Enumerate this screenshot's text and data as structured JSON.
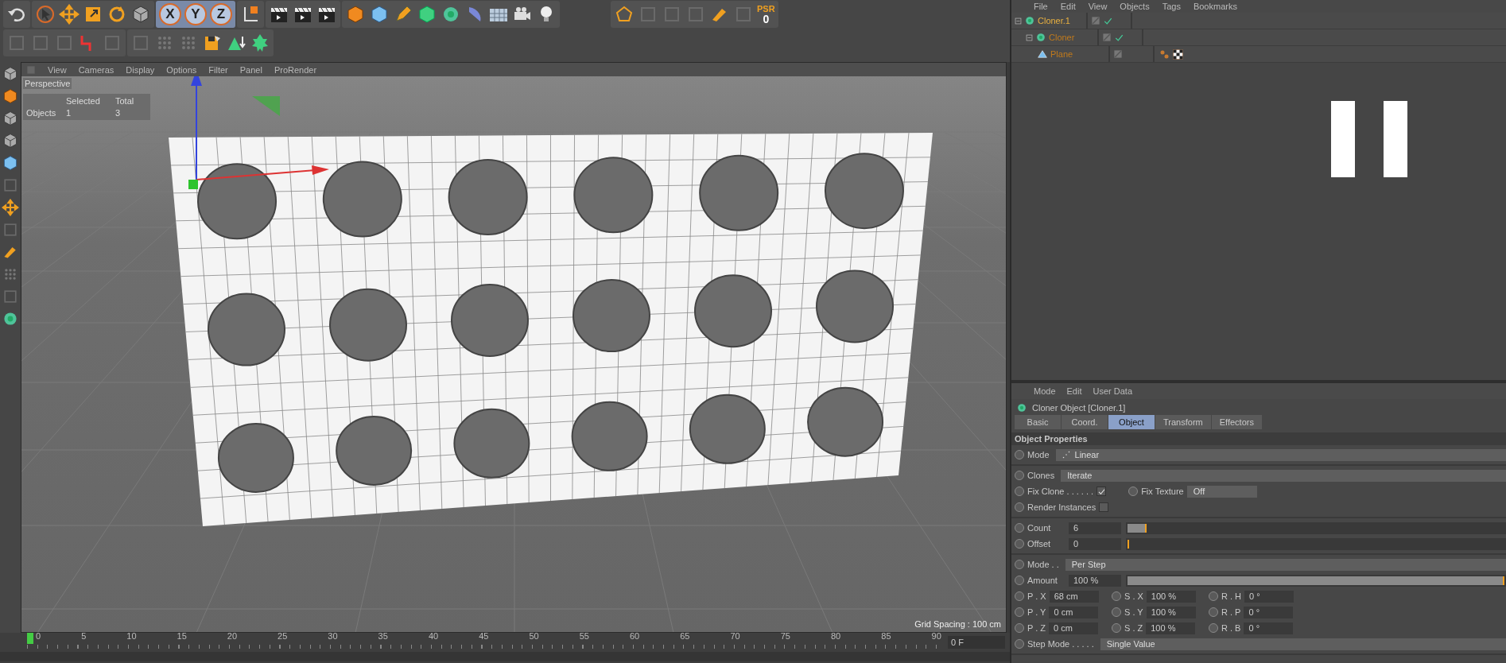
{
  "toolbar": {
    "axis_buttons": [
      {
        "label": "X",
        "selected": true
      },
      {
        "label": "Y",
        "selected": true
      },
      {
        "label": "Z",
        "selected": true
      }
    ],
    "psr": {
      "label": "PSR",
      "value": "0"
    }
  },
  "viewport": {
    "menu": [
      "View",
      "Cameras",
      "Display",
      "Options",
      "Filter",
      "Panel",
      "ProRender"
    ],
    "camera": "Perspective",
    "stats": {
      "columns": [
        "Selected",
        "Total"
      ],
      "rows": [
        {
          "label": "Objects",
          "selected": "1",
          "total": "3"
        }
      ]
    },
    "grid_spacing": "Grid Spacing : 100 cm"
  },
  "timeline": {
    "ticks": [
      "0",
      "5",
      "10",
      "15",
      "20",
      "25",
      "30",
      "35",
      "40",
      "45",
      "50",
      "55",
      "60",
      "65",
      "70",
      "75",
      "80",
      "85",
      "90"
    ],
    "frame": "0 F"
  },
  "object_manager": {
    "menu": [
      "File",
      "Edit",
      "View",
      "Objects",
      "Tags",
      "Bookmarks"
    ],
    "tree": [
      {
        "name": "Cloner.1",
        "kind": "cloner",
        "active": true,
        "enabled": true,
        "expanded": true,
        "children": [
          {
            "name": "Cloner",
            "kind": "cloner",
            "active": false,
            "enabled": true,
            "expanded": true,
            "children": [
              {
                "name": "Plane",
                "kind": "plane",
                "active": false,
                "enabled": false,
                "tags": true
              }
            ]
          }
        ]
      }
    ]
  },
  "attributes": {
    "menu": [
      "Mode",
      "Edit",
      "User Data"
    ],
    "title": "Cloner Object [Cloner.1]",
    "tabs": [
      {
        "label": "Basic",
        "selected": false
      },
      {
        "label": "Coord.",
        "selected": false
      },
      {
        "label": "Object",
        "selected": true
      },
      {
        "label": "Transform",
        "selected": false
      },
      {
        "label": "Effectors",
        "selected": false
      }
    ],
    "section": "Object Properties",
    "groups": [
      [
        {
          "kind": "dropdown",
          "label": "Mode",
          "value": "Linear",
          "dotted": true
        }
      ],
      [
        {
          "kind": "dropdown",
          "label": "Clones",
          "value": "Iterate"
        },
        {
          "kind": "check_dropdown",
          "label": "Fix Clone . . . . . .",
          "checked": true,
          "label2": "Fix Texture",
          "value": "Off"
        },
        {
          "kind": "checkbox",
          "label": "Render Instances",
          "checked": false
        }
      ],
      [
        {
          "kind": "slider",
          "label": "Count",
          "value": "6",
          "level": 0.05
        },
        {
          "kind": "slider",
          "label": "Offset",
          "value": "0",
          "level": 0
        }
      ],
      [
        {
          "kind": "dropdown",
          "label": "Mode . .",
          "value": "Per Step"
        },
        {
          "kind": "slider",
          "label": "Amount",
          "value": "100 %",
          "level": 1
        },
        {
          "kind": "triple",
          "cells": [
            {
              "label": "P . X",
              "value": "68 cm"
            },
            {
              "label": "S . X",
              "value": "100 %"
            },
            {
              "label": "R . H",
              "value": "0 °"
            }
          ]
        },
        {
          "kind": "triple",
          "cells": [
            {
              "label": "P . Y",
              "value": "0 cm"
            },
            {
              "label": "S . Y",
              "value": "100 %"
            },
            {
              "label": "R . P",
              "value": "0 °"
            }
          ]
        },
        {
          "kind": "triple",
          "cells": [
            {
              "label": "P . Z",
              "value": "0 cm"
            },
            {
              "label": "S . Z",
              "value": "100 %"
            },
            {
              "label": "R . B",
              "value": "0 °"
            }
          ]
        },
        {
          "kind": "dropdown",
          "label": "Step Mode . . . . .",
          "value": "Single Value"
        }
      ]
    ]
  }
}
